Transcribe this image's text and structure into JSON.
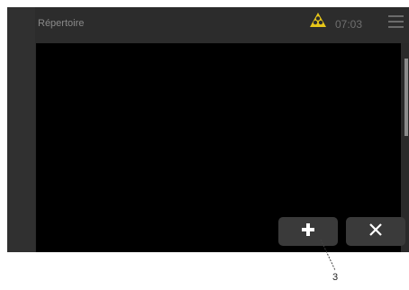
{
  "header": {
    "title": "Répertoire",
    "time": "07:03",
    "warning_icon": "warning-triangle-icon",
    "menu_icon": "hamburger-menu-icon"
  },
  "buttons": {
    "add_icon": "plus-icon",
    "close_icon": "close-icon"
  },
  "annotation": {
    "label": "3"
  },
  "colors": {
    "background": "#000000",
    "header": "#2c2c2c",
    "warning": "#e6c619",
    "button": "#3a3a3a"
  }
}
